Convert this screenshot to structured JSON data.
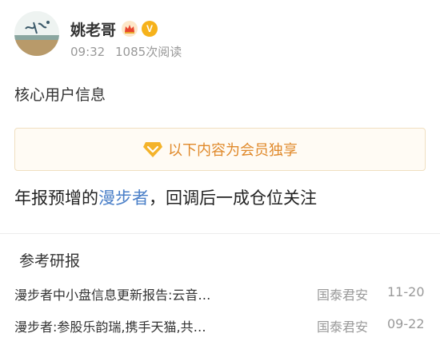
{
  "author": {
    "name": "姚老哥",
    "time": "09:32",
    "reads": "1085次阅读",
    "vip_badge": "V",
    "badge_color": "#f6b21b"
  },
  "section_label": "核心用户信息",
  "vip_notice": "以下内容为会员独享",
  "post": {
    "prefix": "年报预增的",
    "link_text": "漫步者",
    "suffix": "，回调后一成仓位关注",
    "link_color": "#4a7fc8"
  },
  "references": {
    "title": "参考研报",
    "items": [
      {
        "title": "漫步者中小盘信息更新报告:云音…",
        "source": "国泰君安",
        "date": "11-20"
      },
      {
        "title": "漫步者:参股乐韵瑞,携手天猫,共…",
        "source": "国泰君安",
        "date": "09-22"
      }
    ]
  },
  "icons": {
    "avatar": "profile-avatar",
    "crown": "crown-icon",
    "vip": "diamond-vip-icon"
  }
}
